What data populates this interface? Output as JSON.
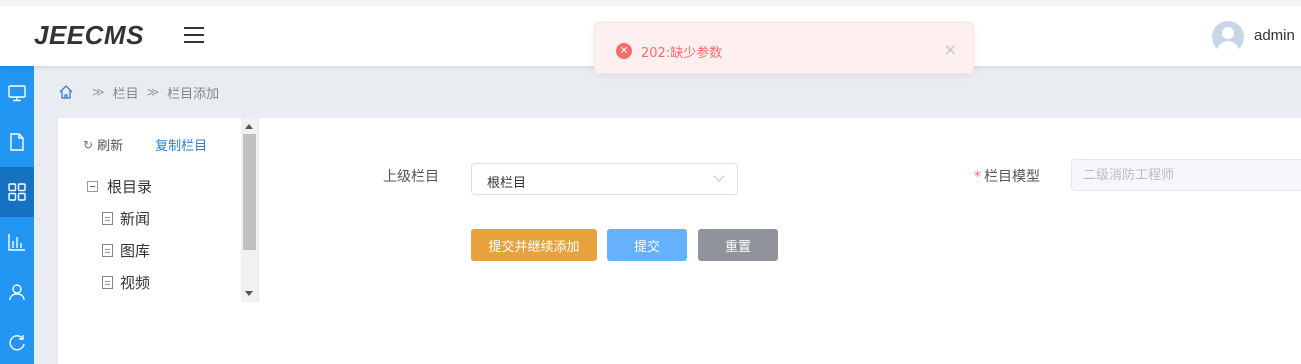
{
  "header": {
    "logo": "JEECMS",
    "username": "admin"
  },
  "toast": {
    "message": "202:缺少参数",
    "close_glyph": "×",
    "icon_glyph": "✕",
    "color": "#f56c6c"
  },
  "sidebar": {
    "color": "#2196f3",
    "active_color": "#1673c4",
    "items": [
      {
        "icon": "monitor-icon"
      },
      {
        "icon": "document-icon"
      },
      {
        "icon": "grid-icon",
        "active": true
      },
      {
        "icon": "bar-chart-icon"
      },
      {
        "icon": "user-icon"
      },
      {
        "icon": "refresh-circle-icon"
      }
    ]
  },
  "breadcrumb": {
    "separator": "≫",
    "items": [
      "栏目",
      "栏目添加"
    ]
  },
  "tree": {
    "refresh_icon": "↻",
    "refresh_label": "刷新",
    "copy_label": "复制栏目",
    "root": "根目录",
    "children": [
      "新闻",
      "图库",
      "视频"
    ]
  },
  "form": {
    "parent_label": "上级栏目",
    "parent_value": "根栏目",
    "model_label": "栏目模型",
    "required_mark": "*",
    "model_placeholder": "二级消防工程师"
  },
  "buttons": {
    "submit_continue": "提交并继续添加",
    "submit": "提交",
    "reset": "重置",
    "colors": {
      "orange": "#e6a23c",
      "blue": "#66b1ff",
      "gray": "#909399"
    }
  }
}
